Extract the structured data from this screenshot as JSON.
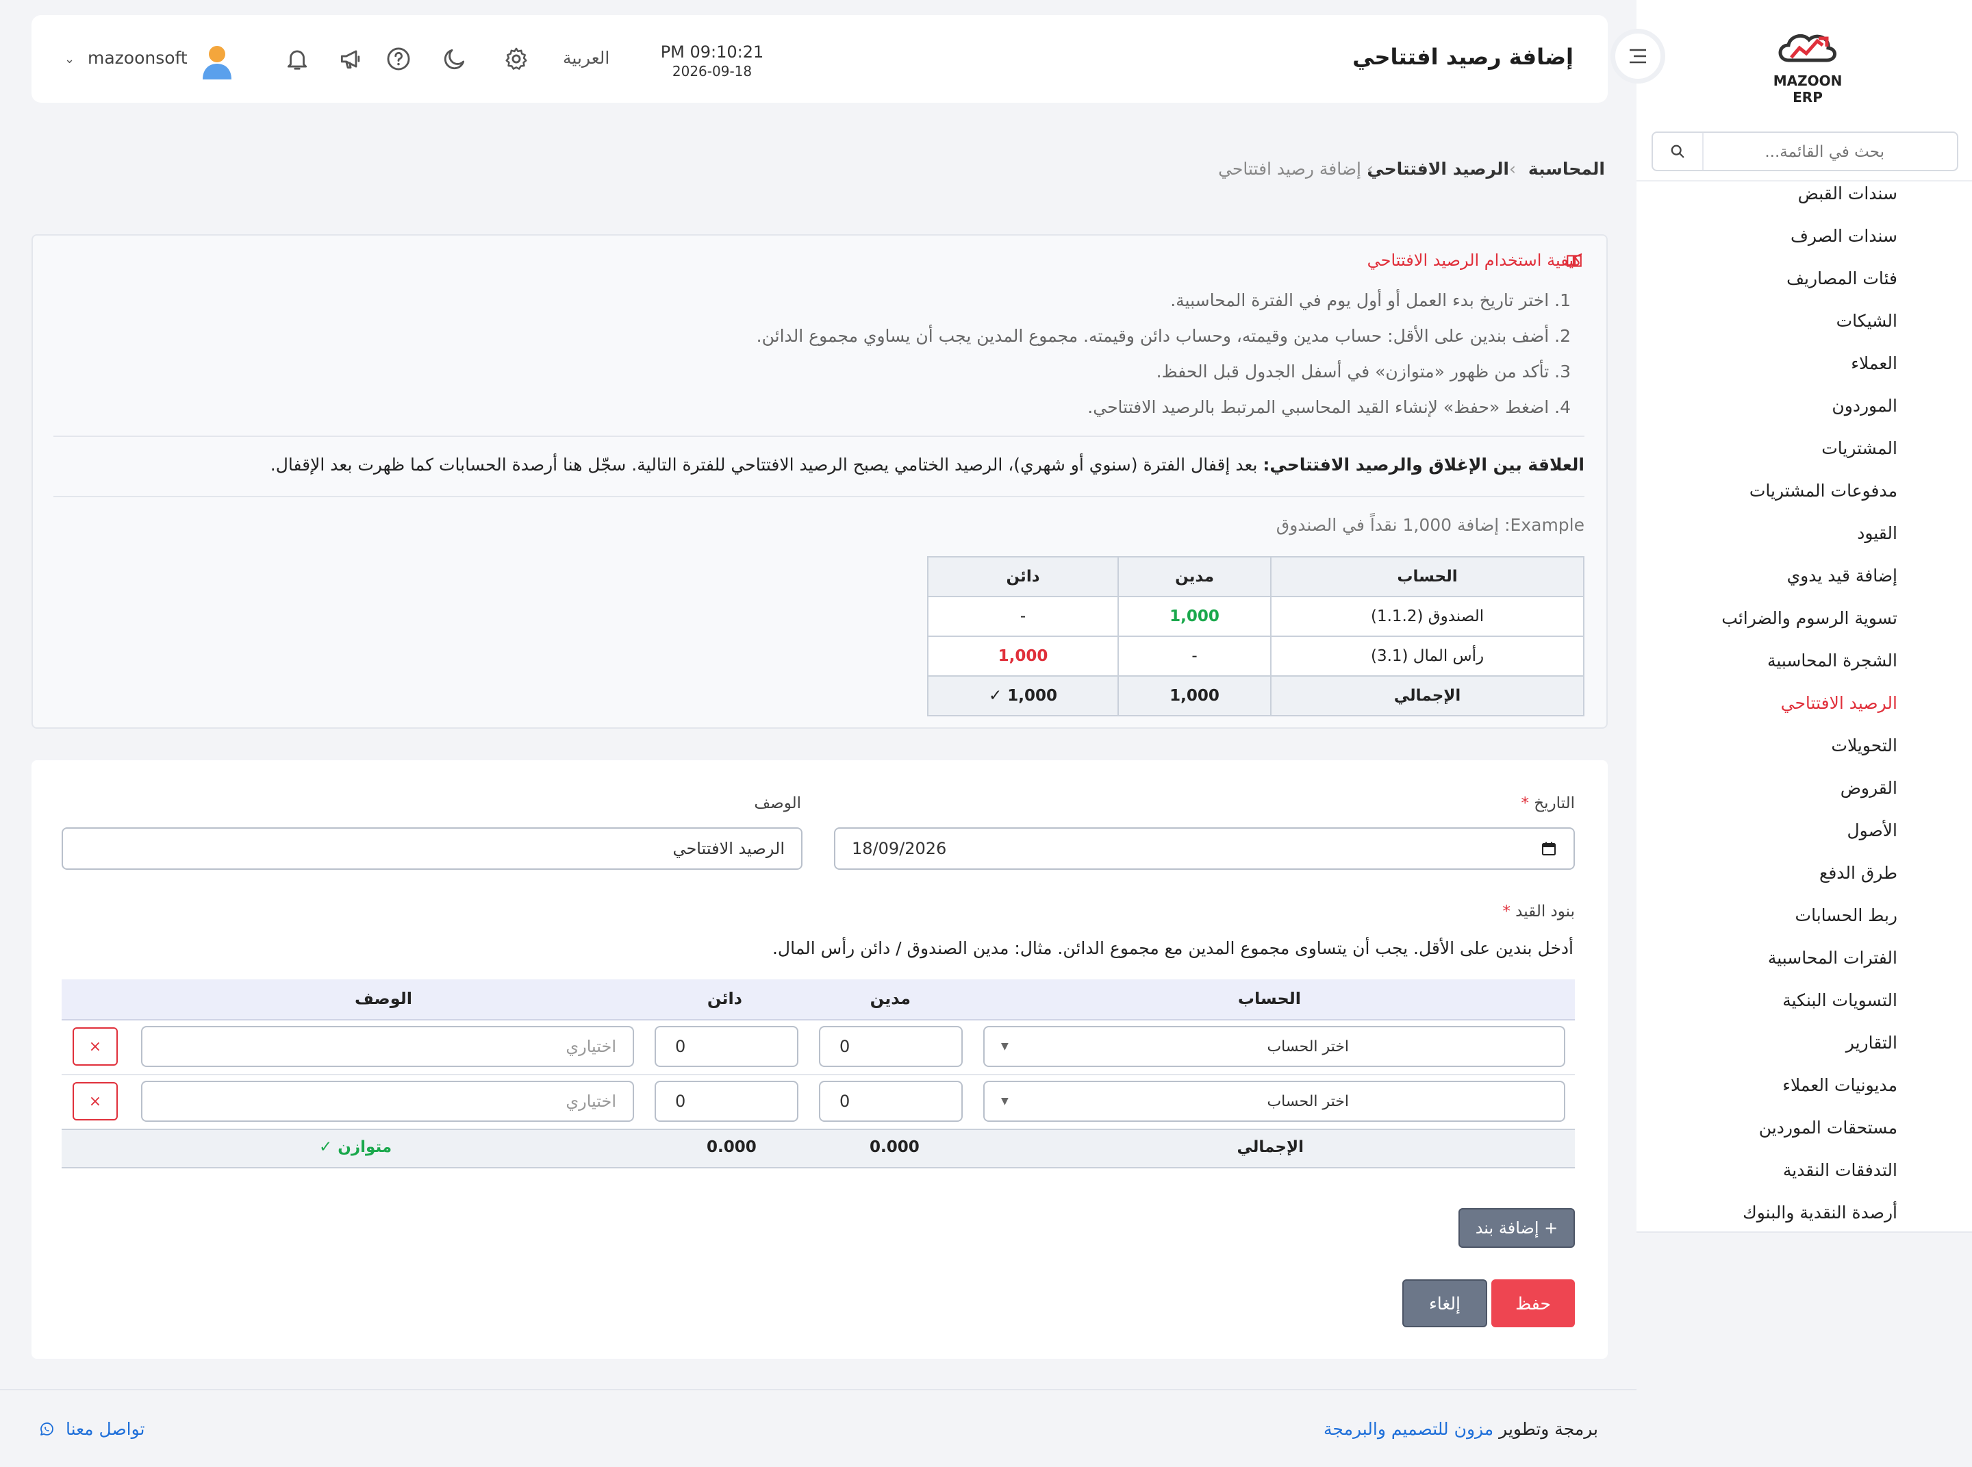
{
  "app": {
    "logo_text": "MAZOON ERP",
    "logo_small": "ERP",
    "accent_color": "#e0303b",
    "success_color": "#1aa84c",
    "link_color": "#1e6fd9"
  },
  "sidebar": {
    "search_placeholder": "بحث في القائمة...",
    "items": [
      {
        "label": "سندات القبض"
      },
      {
        "label": "سندات الصرف"
      },
      {
        "label": "فئات المصاريف"
      },
      {
        "label": "الشيكات"
      },
      {
        "label": "العملاء"
      },
      {
        "label": "الموردون"
      },
      {
        "label": "المشتريات"
      },
      {
        "label": "مدفوعات المشتريات"
      },
      {
        "label": "القيود"
      },
      {
        "label": "إضافة قيد يدوي"
      },
      {
        "label": "تسوية الرسوم والضرائب"
      },
      {
        "label": "الشجرة المحاسبية"
      },
      {
        "label": "الرصيد الافتتاحي",
        "active": true
      },
      {
        "label": "التحويلات"
      },
      {
        "label": "القروض"
      },
      {
        "label": "الأصول"
      },
      {
        "label": "طرق الدفع"
      },
      {
        "label": "ربط الحسابات"
      },
      {
        "label": "الفترات المحاسبية"
      },
      {
        "label": "التسويات البنكية"
      },
      {
        "label": "التقارير"
      },
      {
        "label": "مديونيات العملاء"
      },
      {
        "label": "مستحقات الموردين"
      },
      {
        "label": "التدفقات النقدية"
      },
      {
        "label": "أرصدة النقدية والبنوك"
      }
    ]
  },
  "header": {
    "title": "إضافة رصيد افتتاحي",
    "time": "PM 09:10:21",
    "date": "2026-09-18",
    "language": "العربية",
    "username": "mazoonsoft"
  },
  "breadcrumb": {
    "root": "المحاسبة",
    "parent": "الرصيد الافتتاحي",
    "current": "إضافة رصيد افتتاحي"
  },
  "info": {
    "heading": "كيفية استخدام الرصيد الافتتاحي",
    "steps": [
      "1. اختر تاريخ بدء العمل أو أول يوم في الفترة المحاسبية.",
      "2. أضف بندين على الأقل: حساب مدين وقيمته، وحساب دائن وقيمته. مجموع المدين يجب أن يساوي مجموع الدائن.",
      "3. تأكد من ظهور «متوازن» في أسفل الجدول قبل الحفظ.",
      "4. اضغط «حفظ» لإنشاء القيد المحاسبي المرتبط بالرصيد الافتتاحي."
    ],
    "relation_bold": "العلاقة بين الإغلاق والرصيد الافتتاحي:",
    "relation_text": " بعد إقفال الفترة (سنوي أو شهري)، الرصيد الختامي يصبح الرصيد الافتتاحي للفترة التالية. سجّل هنا أرصدة الحسابات كما ظهرت بعد الإقفال.",
    "example": "Example: إضافة 1,000 نقداً في الصندوق",
    "table": {
      "headers": [
        "الحساب",
        "مدين",
        "دائن"
      ],
      "rows": [
        {
          "account": "الصندوق (1.1.2)",
          "debit": "1,000",
          "credit": "-"
        },
        {
          "account": "رأس المال (3.1)",
          "debit": "-",
          "credit": "1,000"
        }
      ],
      "total": {
        "label": "الإجمالي",
        "debit": "1,000",
        "credit": "1,000 ✓"
      }
    }
  },
  "form": {
    "date_label": "التاريخ",
    "date_value": "18/09/2026",
    "desc_label": "الوصف",
    "desc_value": "الرصيد الافتتاحي",
    "lines_label": "بنود القيد",
    "hint": "أدخل بندين على الأقل. يجب أن يتساوى مجموع المدين مع مجموع الدائن. مثال: مدين الصندوق / دائن رأس المال.",
    "columns": {
      "account": "الحساب",
      "debit": "مدين",
      "credit": "دائن",
      "description": "الوصف"
    },
    "lines": [
      {
        "account": "اختر الحساب",
        "debit": "0",
        "credit": "0",
        "description_placeholder": "اختياري",
        "delete": "×"
      },
      {
        "account": "اختر الحساب",
        "debit": "0",
        "credit": "0",
        "description_placeholder": "اختياري",
        "delete": "×"
      }
    ],
    "totals": {
      "label": "الإجمالي",
      "debit": "0.000",
      "credit": "0.000",
      "status": "✓ متوازن"
    },
    "add_line": "+ إضافة بند",
    "save": "حفظ",
    "cancel": "إلغاء"
  },
  "footer": {
    "credit_prefix": "برمجة وتطوير",
    "credit_link": "مزون للتصميم والبرمجة",
    "contact": "تواصل معنا"
  }
}
